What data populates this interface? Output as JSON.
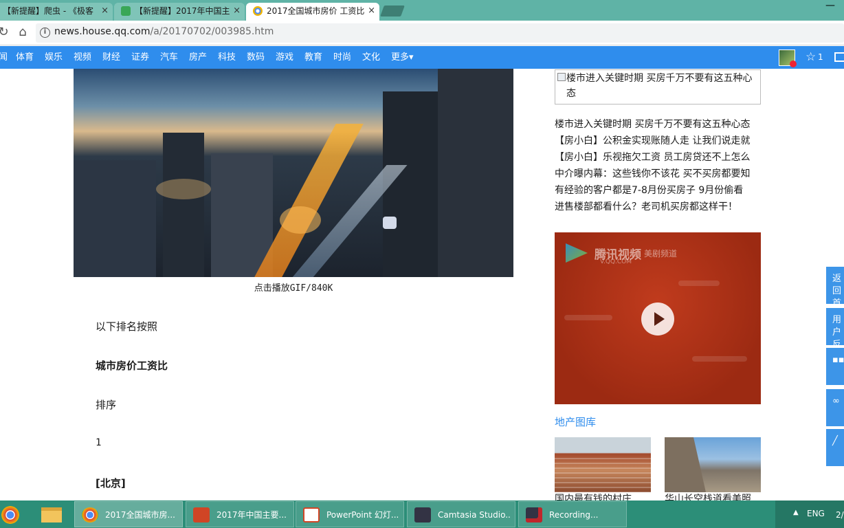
{
  "browser": {
    "tabs": [
      {
        "title": "【新提醒】爬虫 - 《极客",
        "active": false
      },
      {
        "title": "【新提醒】2017年中国主",
        "active": false
      },
      {
        "title": "2017全国城市房价 工资比",
        "active": true
      }
    ],
    "tab_close_glyph": "×",
    "minimize_glyph": "—",
    "url_host": "news.house.qq.com",
    "url_path": "/a/20170702/003985.htm",
    "info_glyph": "i"
  },
  "site_nav": {
    "items": [
      "闻",
      "体育",
      "娱乐",
      "视频",
      "财经",
      "证券",
      "汽车",
      "房产",
      "科技",
      "数码",
      "游戏",
      "教育",
      "时尚",
      "文化",
      "更多▾"
    ],
    "star_count": "1"
  },
  "article": {
    "image_caption": "点击播放GIF/840K",
    "paragraphs": [
      "以下排名按照",
      "城市房价工资比",
      "排序",
      "1",
      "[北京]"
    ]
  },
  "sidebar": {
    "broken_image_alt": "楼市进入关键时期 买房千万不要有这五种心态",
    "headlines": [
      "楼市进入关键时期 买房千万不要有这五种心态",
      "【房小白】公积金实现账随人走 让我们说走就",
      "【房小白】乐视拖欠工资 员工房贷还不上怎么",
      "中介曝内幕：这些钱你不该花 买不买房都要知",
      "有经验的客户都是7-8月份买房子 9月份偷看",
      "进售楼部都看什么？老司机买房都这样干！"
    ],
    "video": {
      "brand": "腾讯视频",
      "brand_domain": "V.QQ.COM",
      "brand_channel": "美剧频道"
    },
    "section_title": "地产图库",
    "gallery_captions": [
      "国内最有钱的村庄",
      "华山长空栈道看美照"
    ]
  },
  "floating_buttons": [
    "返回首页",
    "用户反馈",
    "",
    "",
    ""
  ],
  "taskbar": {
    "tasks": [
      {
        "label": "2017全国城市房...",
        "active": true
      },
      {
        "label": "2017年中国主要...",
        "active": false
      },
      {
        "label": "PowerPoint 幻灯...",
        "active": false
      },
      {
        "label": "Camtasia Studio...",
        "active": false
      },
      {
        "label": "Recording...",
        "active": false
      }
    ],
    "tray_lang": "ENG",
    "tray_clock": "2/"
  },
  "colors": {
    "tab_strip": "#5fb3a6",
    "site_nav": "#2f8ded",
    "taskbar": "#2c8e78",
    "link": "#2f8ded"
  }
}
